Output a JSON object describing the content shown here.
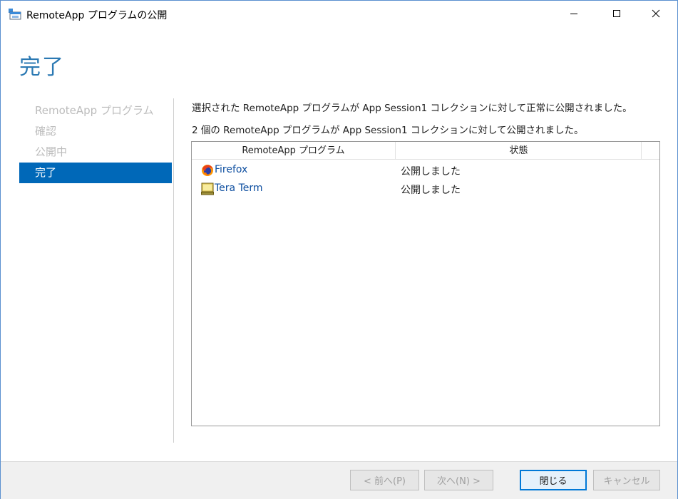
{
  "window": {
    "title": "RemoteApp プログラムの公開",
    "icons": {
      "app": "remoteapp-window-icon",
      "minimize": "minimize-icon",
      "maximize": "maximize-icon",
      "close": "close-icon"
    }
  },
  "page": {
    "title": "完了"
  },
  "nav": {
    "items": [
      {
        "label": "RemoteApp プログラム",
        "active": false
      },
      {
        "label": "確認",
        "active": false
      },
      {
        "label": "公開中",
        "active": false
      },
      {
        "label": "完了",
        "active": true
      }
    ]
  },
  "messages": {
    "line1": "選択された RemoteApp プログラムが App Session1 コレクションに対して正常に公開されました。",
    "line2": "2 個の RemoteApp プログラムが App Session1 コレクションに対して公開されました。"
  },
  "list": {
    "columns": [
      "RemoteApp プログラム",
      "状態"
    ],
    "rows": [
      {
        "name": "Firefox",
        "status": "公開しました",
        "icon": "firefox-icon"
      },
      {
        "name": "Tera Term",
        "status": "公開しました",
        "icon": "tera-term-icon"
      }
    ]
  },
  "buttons": {
    "prev": "< 前へ(P)",
    "next": "次へ(N) >",
    "close": "閉じる",
    "cancel": "キャンセル"
  },
  "colors": {
    "accent": "#0068b8",
    "title": "#2b79b3",
    "link": "#0e4fa0"
  }
}
